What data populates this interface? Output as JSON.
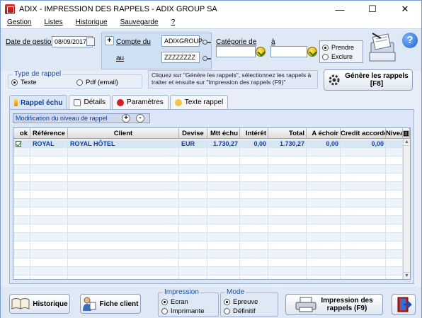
{
  "window": {
    "title": "ADIX - IMPRESSION DES RAPPELS - ADIX GROUP SA",
    "min": "—",
    "max": "☐",
    "close": "✕"
  },
  "menu": [
    "Gestion",
    "Listes",
    "Historique",
    "Sauvegarde",
    "?"
  ],
  "header": {
    "date_label": "Date de gestion",
    "date_value": "08/09/2017",
    "compte_du_label": "Compte du",
    "compte_du_value": "ADIXGROUP",
    "au_label": "au",
    "au_value": "ZZZZZZZZ",
    "categorie_label": "Catégorie de",
    "a_label": "à",
    "categorie_de_value": "",
    "categorie_a_value": "",
    "prendre_label": "Prendre",
    "exclure_label": "Exclure",
    "help_glyph": "?"
  },
  "type_rappel": {
    "legend": "Type de rappel",
    "texte_label": "Texte",
    "pdf_label": "Pdf (email)",
    "selected": "Texte"
  },
  "instructions": "Cliquez sur \"Génère les rappels\", sélectionnez les rappels à traiter et ensuite sur \"Impression des rappels (F9)\"",
  "genere_button": {
    "line1": "Génère les rappels",
    "line2": "[F8]"
  },
  "tabs": [
    "Rappel échu",
    "Détails",
    "Paramètres",
    "Texte rappel"
  ],
  "modif_label": "Modification du niveau de rappel",
  "modif_plus": "+",
  "modif_minus": "-",
  "grid": {
    "columns": [
      "ok",
      "Référence",
      "Client",
      "Devise",
      "Mtt échu",
      "Intérêt",
      "Total",
      "A échoir",
      "Credit accordé",
      "Niveau"
    ],
    "rows": [
      {
        "ok": true,
        "reference": "ROYAL",
        "client": "ROYAL HÔTEL",
        "devise": "EUR",
        "mtt_echu": "1.730,27",
        "interet": "0,00",
        "total": "1.730,27",
        "a_echoir": "0,00",
        "credit": "0,00",
        "niveau": ""
      }
    ]
  },
  "bottom": {
    "historique_label": "Historique",
    "fiche_client_label": "Fiche client",
    "impression_legend": "Impression",
    "ecran_label": "Ecran",
    "imprimante_label": "Imprimante",
    "mode_legend": "Mode",
    "epreuve_label": "Epreuve",
    "definitif_label": "Définitif",
    "impression_button_line1": "Impression des",
    "impression_button_line2": "rappels (F9)"
  },
  "colors": {
    "accent": "#1040a0",
    "panel": "#dbe7f7",
    "selected_row_text": "#1040a0"
  }
}
